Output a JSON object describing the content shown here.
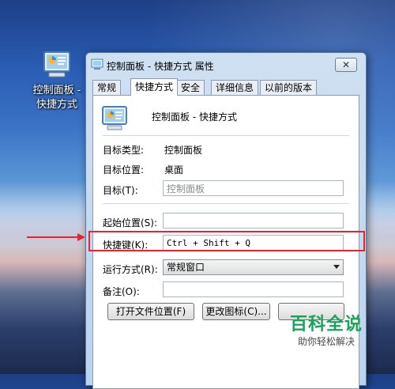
{
  "desktop": {
    "icon_label_line1": "控制面板 -",
    "icon_label_line2": "快捷方式"
  },
  "dialog": {
    "title": "控制面板 - 快捷方式 属性",
    "close_glyph": "✕",
    "tabs": [
      "常规",
      "快捷方式",
      "安全",
      "详细信息",
      "以前的版本"
    ],
    "active_tab": "快捷方式",
    "shortcut_name": "控制面板 - 快捷方式",
    "target_type_label": "目标类型:",
    "target_type_value": "控制面板",
    "target_location_label": "目标位置:",
    "target_location_value": "桌面",
    "target_label": "目标(T):",
    "target_value": "控制面板",
    "start_in_label": "起始位置(S):",
    "start_in_value": "",
    "hotkey_label": "快捷键(K):",
    "hotkey_value": "Ctrl + Shift + Q",
    "run_label": "运行方式(R):",
    "run_value": "常规窗口",
    "comment_label": "备注(O):",
    "comment_value": "",
    "open_location_button": "打开文件位置(F)",
    "change_icon_button": "更改图标(C)..."
  },
  "watermark": {
    "main": "百科全说",
    "sub": "助你轻松解决"
  },
  "colors": {
    "annotation_red": "#e8232a",
    "watermark_green": "#17a35a"
  }
}
